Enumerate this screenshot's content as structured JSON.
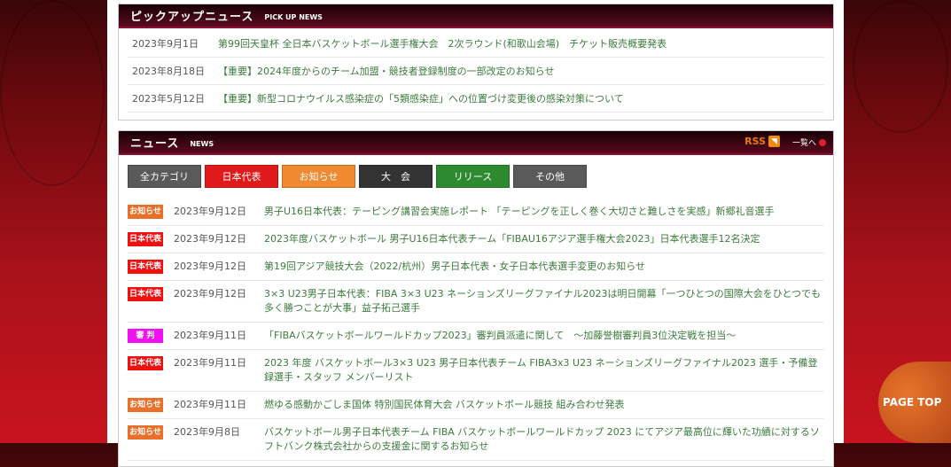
{
  "pickup": {
    "title": "ピックアップニュース",
    "subtitle": "PICK UP NEWS",
    "items": [
      {
        "date": "2023年9月1日",
        "text": "第99回天皇杯 全日本バスケットボール選手権大会　2次ラウンド(和歌山会場)　チケット販売概要発表"
      },
      {
        "date": "2023年8月18日",
        "text": "【重要】2024年度からのチーム加盟・競技者登録制度の一部改定のお知らせ"
      },
      {
        "date": "2023年5月12日",
        "text": "【重要】新型コロナウイルス感染症の「5類感染症」への位置づけ変更後の感染対策について"
      }
    ]
  },
  "news": {
    "title": "ニュース",
    "subtitle": "NEWS",
    "rss": "RSS",
    "rss_icon": "rss-icon",
    "more": "一覧へ",
    "filters": [
      {
        "label": "全カテゴリ",
        "color": "#5a5a5a"
      },
      {
        "label": "日本代表",
        "color": "#e01a1a"
      },
      {
        "label": "お知らせ",
        "color": "#f08a30"
      },
      {
        "label": "大　会",
        "color": "#333333"
      },
      {
        "label": "リリース",
        "color": "#2e8a2e"
      },
      {
        "label": "その他",
        "color": "#5a5a5a"
      }
    ],
    "items": [
      {
        "badge": "お知らせ",
        "badge_color": "#e8702a",
        "date": "2023年9月12日",
        "text": "男子U16日本代表：テーピング講習会実施レポート 「テーピングを正しく巻く大切さと難しさを実感」新郷礼音選手"
      },
      {
        "badge": "日本代表",
        "badge_color": "#f01010",
        "date": "2023年9月12日",
        "text": "2023年度バスケットボール 男子U16日本代表チーム「FIBAU16アジア選手権大会2023」日本代表選手12名決定"
      },
      {
        "badge": "日本代表",
        "badge_color": "#f01010",
        "date": "2023年9月12日",
        "text": "第19回アジア競技大会（2022/杭州）男子日本代表・女子日本代表選手変更のお知らせ"
      },
      {
        "badge": "日本代表",
        "badge_color": "#f01010",
        "date": "2023年9月12日",
        "text": "3×3 U23男子日本代表：FIBA 3×3 U23 ネーションズリーグファイナル2023は明日開幕「一つひとつの国際大会をひとつでも多く勝つことが大事」益子拓己選手"
      },
      {
        "badge": "審 判",
        "badge_color": "#f010f0",
        "date": "2023年9月11日",
        "text": "「FIBAバスケットボールワールドカップ2023」審判員派遣に関して　～加藤誉樹審判員3位決定戦を担当～"
      },
      {
        "badge": "日本代表",
        "badge_color": "#f01010",
        "date": "2023年9月11日",
        "text": "2023 年度 バスケットボール3×3 U23 男子日本代表チーム FIBA3x3 U23 ネーションズリーグファイナル2023 選手・予備登録選手・スタッフ メンバーリスト"
      },
      {
        "badge": "お知らせ",
        "badge_color": "#e8702a",
        "date": "2023年9月11日",
        "text": "燃ゆる感動かごしま国体 特別国民体育大会 バスケットボール競技 組み合わせ発表"
      },
      {
        "badge": "お知らせ",
        "badge_color": "#e8702a",
        "date": "2023年9月8日",
        "text": "バスケットボール男子日本代表チーム FIBA バスケットボールワールドカップ 2023 にてアジア最高位に輝いた功績に対するソフトバンク株式会社からの支援金に関するお知らせ"
      }
    ]
  },
  "page_top": "PAGE TOP"
}
